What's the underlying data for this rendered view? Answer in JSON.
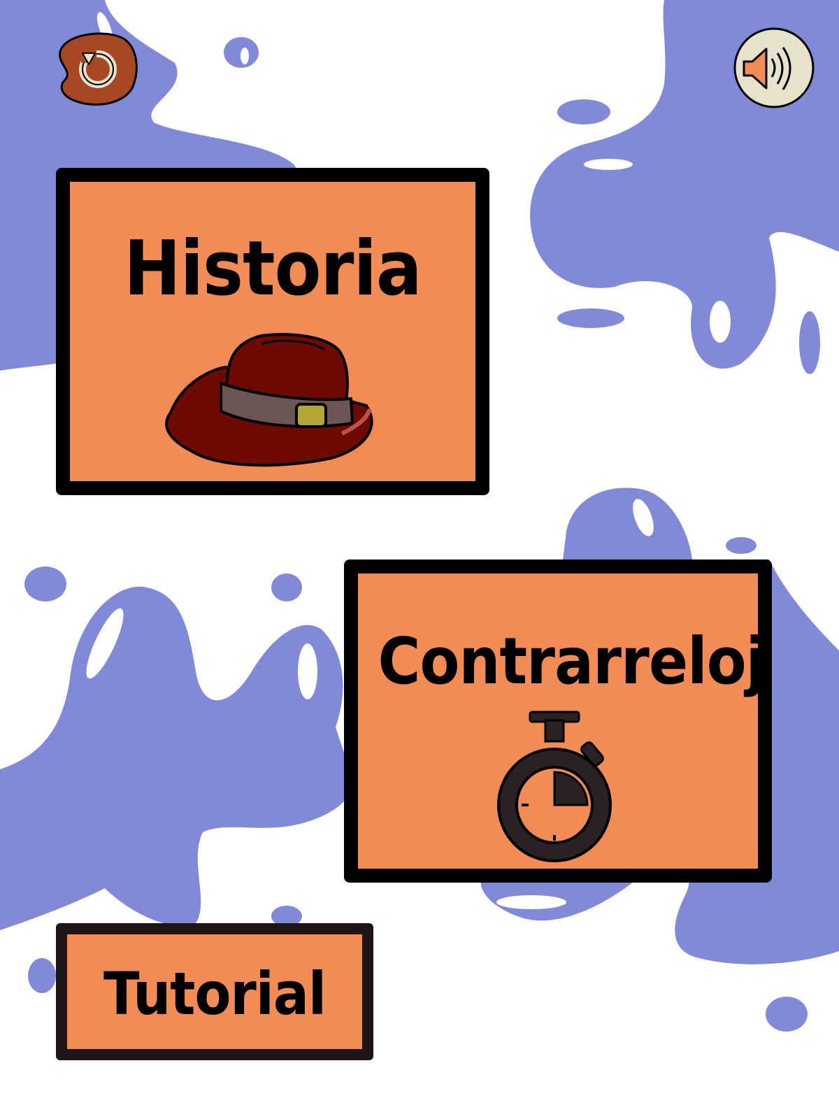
{
  "menu": {
    "historia_label": "Historia",
    "contrarreloj_label": "Contrarreloj",
    "tutorial_label": "Tutorial"
  },
  "icons": {
    "back": "restart-arrow-icon",
    "sound": "speaker-icon",
    "historia_art": "fedora-hat-icon",
    "contrarreloj_art": "stopwatch-icon"
  },
  "colors": {
    "background": "#FFFFFF",
    "splash": "#8289D8",
    "card": "#F28B55",
    "card_border": "#000000",
    "back_button": "#A64826",
    "sound_button": "#E6E2CC",
    "hat": "#6D0A02",
    "hat_band": "#6B5555",
    "hat_buckle": "#B5A532"
  }
}
